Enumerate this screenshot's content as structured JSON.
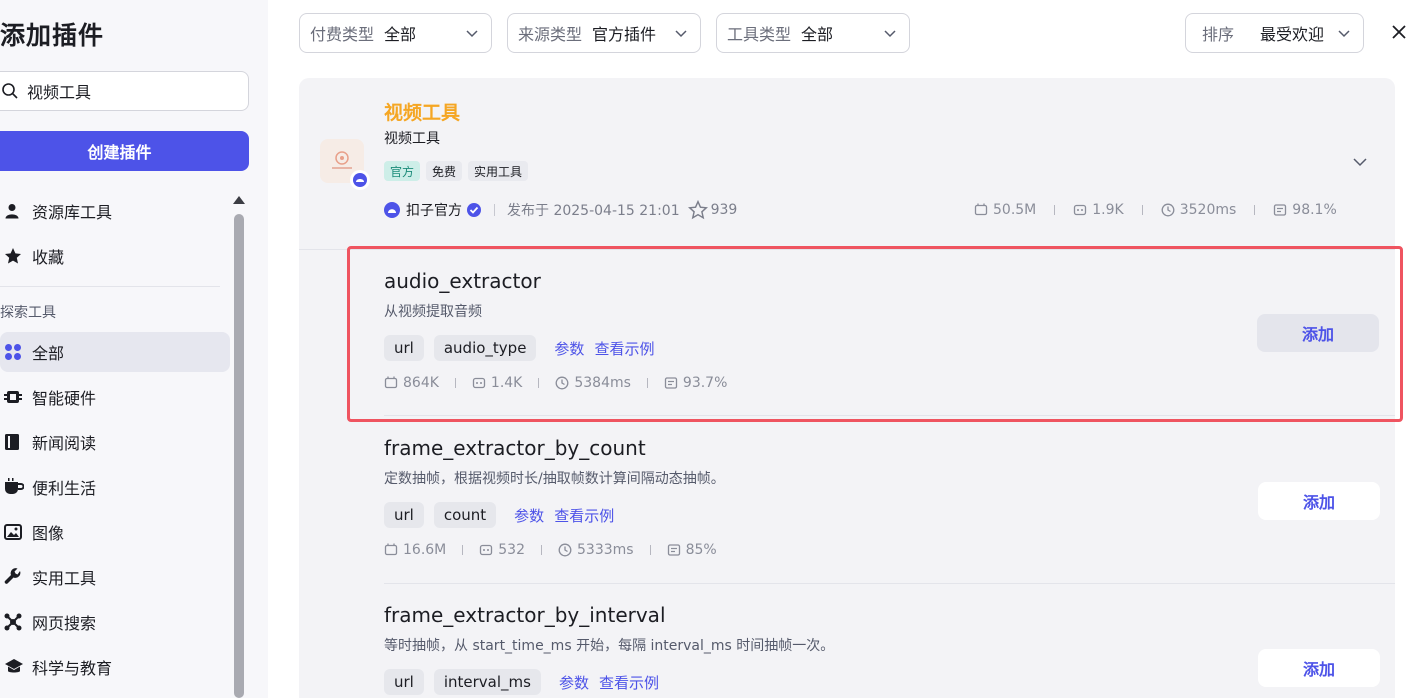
{
  "sidebar": {
    "title": "添加插件",
    "search_value": "视频工具",
    "create_label": "创建插件",
    "items_top": [
      {
        "label": "资源库工具",
        "icon": "user-icon"
      },
      {
        "label": "收藏",
        "icon": "star-icon"
      }
    ],
    "section_label": "探索工具",
    "items": [
      {
        "label": "全部",
        "icon": "grid-icon"
      },
      {
        "label": "智能硬件",
        "icon": "chip-icon"
      },
      {
        "label": "新闻阅读",
        "icon": "book-icon"
      },
      {
        "label": "便利生活",
        "icon": "cup-icon"
      },
      {
        "label": "图像",
        "icon": "image-icon"
      },
      {
        "label": "实用工具",
        "icon": "wrench-icon"
      },
      {
        "label": "网页搜索",
        "icon": "network-icon"
      },
      {
        "label": "科学与教育",
        "icon": "graduation-icon"
      }
    ]
  },
  "filters": {
    "pay": {
      "label": "付费类型",
      "value": "全部"
    },
    "source": {
      "label": "来源类型",
      "value": "官方插件"
    },
    "tool": {
      "label": "工具类型",
      "value": "全部"
    },
    "sort": {
      "label": "排序",
      "value": "最受欢迎"
    }
  },
  "plugin": {
    "name": "视频工具",
    "desc": "视频工具",
    "tags": [
      "官方",
      "免费",
      "实用工具"
    ],
    "author": "扣子官方",
    "published": "发布于 2025-04-15 21:01",
    "stars": "939",
    "stats": [
      "50.5M",
      "1.9K",
      "3520ms",
      "98.1%"
    ]
  },
  "tools": [
    {
      "name": "audio_extractor",
      "desc": "从视频提取音频",
      "params": [
        "url",
        "audio_type"
      ],
      "link_params": "参数",
      "link_example": "查看示例",
      "stats": [
        "864K",
        "1.4K",
        "5384ms",
        "93.7%"
      ],
      "add_label": "添加"
    },
    {
      "name": "frame_extractor_by_count",
      "desc": "定数抽帧，根据视频时长/抽取帧数计算间隔动态抽帧。",
      "params": [
        "url",
        "count"
      ],
      "link_params": "参数",
      "link_example": "查看示例",
      "stats": [
        "16.6M",
        "532",
        "5333ms",
        "85%"
      ],
      "add_label": "添加"
    },
    {
      "name": "frame_extractor_by_interval",
      "desc": "等时抽帧，从 start_time_ms 开始，每隔 interval_ms 时间抽帧一次。",
      "params": [
        "url",
        "interval_ms"
      ],
      "link_params": "参数",
      "link_example": "查看示例",
      "add_label": "添加"
    }
  ],
  "colors": {
    "accent": "#4d53e8",
    "plugin_name": "#f5a623",
    "highlight": "#ef5460"
  }
}
